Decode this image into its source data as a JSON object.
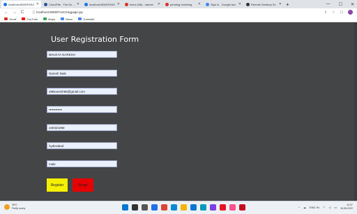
{
  "browser": {
    "tabs": [
      {
        "label": "localhost:8080/FASC",
        "active": true,
        "color": "#1a73e8"
      },
      {
        "label": "CloudFile - The Eurcis",
        "active": false,
        "color": "#2b5797"
      },
      {
        "label": "localhost:8080/FASC",
        "active": false,
        "color": "#1a73e8"
      },
      {
        "label": "Inbox (98) - naresh",
        "active": false,
        "color": "#d93025"
      },
      {
        "label": "pending receiving",
        "active": false,
        "color": "#d93025"
      },
      {
        "label": "Sign in - Google Acc",
        "active": false,
        "color": "#4285f4"
      },
      {
        "label": "Remote Desktop Sc",
        "active": false,
        "color": "#333333"
      }
    ],
    "new_tab": "+",
    "window_controls": {
      "minimize": "—",
      "maximize": "☐",
      "close": "✕"
    },
    "address": {
      "back": "←",
      "forward": "→",
      "reload": "C",
      "info": "ⓘ",
      "url": "localhost:8080/FASC/regpage.jsp",
      "share": "⇪",
      "star": "☆",
      "extensions": "☐"
    },
    "bookmarks": [
      {
        "label": "Gmail",
        "color": "#d93025"
      },
      {
        "label": "YouTube",
        "color": "#ff0000"
      },
      {
        "label": "Maps",
        "color": "#34a853"
      },
      {
        "label": "News",
        "color": "#4285f4"
      },
      {
        "label": "Translate",
        "color": "#4285f4"
      }
    ]
  },
  "form": {
    "title": "User Registration Form",
    "fields": [
      {
        "value": "BHUKYA NARESH"
      },
      {
        "value": "Naresh Naik"
      },
      {
        "value": "49Bnaresh98@gmail.com"
      },
      {
        "value": "••••••••••••"
      },
      {
        "value": "23/03/1998"
      },
      {
        "value": "hyderabad"
      },
      {
        "value": "male"
      }
    ],
    "register_label": "Register",
    "reset_label": "Reset",
    "colors": {
      "register": "#f5f000",
      "reset": "#e60000",
      "background": "#434547"
    }
  },
  "taskbar": {
    "weather": {
      "temp": "28°C",
      "desc": "Partly sunny"
    },
    "apps": [
      {
        "name": "windows-start",
        "color": "#0078d4"
      },
      {
        "name": "search",
        "color": "#333333"
      },
      {
        "name": "task-view",
        "color": "#555555"
      },
      {
        "name": "widgets",
        "color": "#1f6feb"
      },
      {
        "name": "chrome",
        "color": "#db4437"
      },
      {
        "name": "edge",
        "color": "#0c8ad6"
      },
      {
        "name": "file-explorer",
        "color": "#f4b400"
      },
      {
        "name": "store",
        "color": "#0078d4"
      },
      {
        "name": "photos",
        "color": "#0099bc"
      },
      {
        "name": "app-a",
        "color": "#7b3fe4"
      },
      {
        "name": "app-b",
        "color": "#e81123"
      },
      {
        "name": "app-c",
        "color": "#ff4f8b"
      },
      {
        "name": "app-d",
        "color": "#c50f1f"
      }
    ],
    "tray": {
      "chevron": "^",
      "lang": "ENG IN",
      "time": "10:37",
      "date": "16-08-2022"
    }
  }
}
